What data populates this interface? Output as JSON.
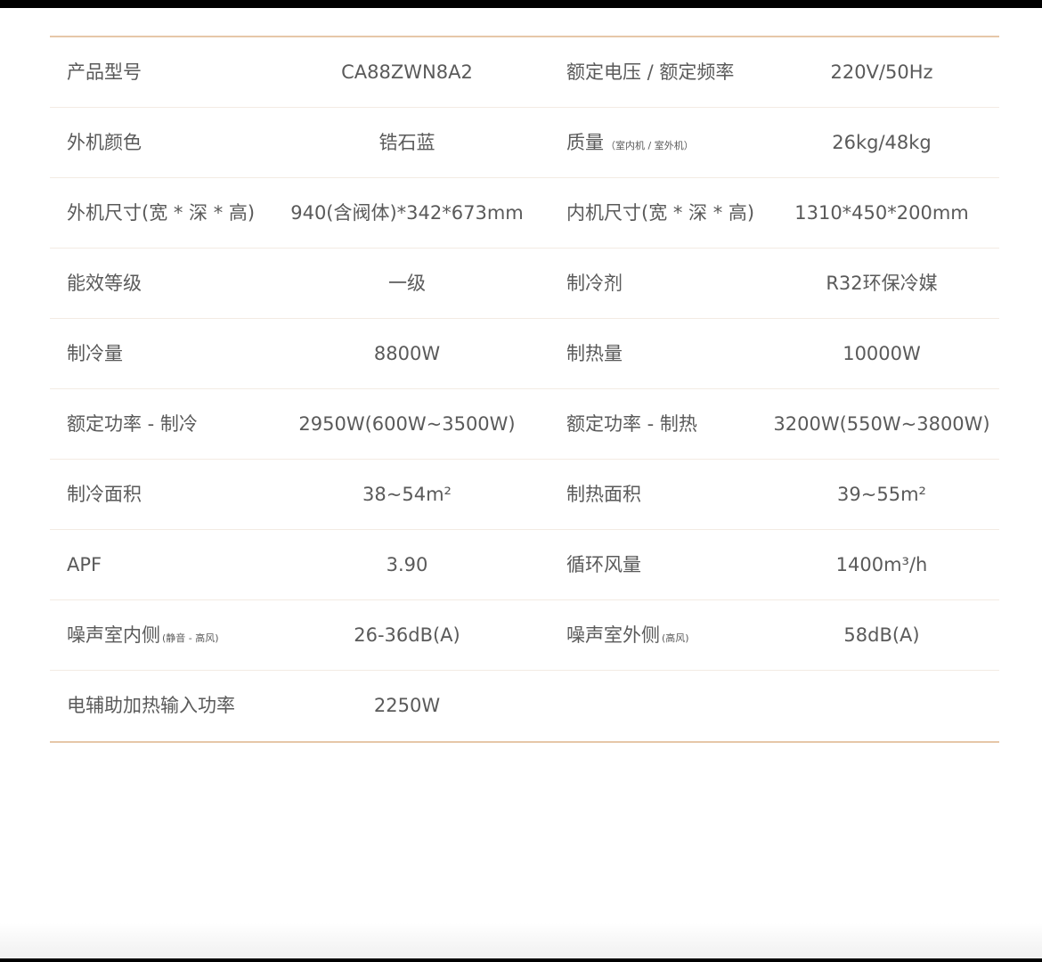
{
  "rows": [
    {
      "label1": "产品型号",
      "value1": "CA88ZWN8A2",
      "label2": "额定电压 / 额定频率",
      "value2": "220V/50Hz"
    },
    {
      "label1": "外机颜色",
      "value1": "锆石蓝",
      "label2": "质量",
      "label2_note": "（室内机 / 室外机）",
      "value2": "26kg/48kg"
    },
    {
      "label1": "外机尺寸(宽 * 深 * 高)",
      "value1": "940(含阀体)*342*673mm",
      "label2": "内机尺寸(宽 * 深 * 高)",
      "value2": "1310*450*200mm"
    },
    {
      "label1": "能效等级",
      "value1": "一级",
      "label2": "制冷剂",
      "value2": "R32环保冷媒"
    },
    {
      "label1": "制冷量",
      "value1": "8800W",
      "label2": "制热量",
      "value2": "10000W"
    },
    {
      "label1": "额定功率 - 制冷",
      "value1": "2950W(600W~3500W)",
      "label2": "额定功率 - 制热",
      "value2": "3200W(550W~3800W)"
    },
    {
      "label1": "制冷面积",
      "value1": "38~54m²",
      "label2": "制热面积",
      "value2": "39~55m²"
    },
    {
      "label1": "APF",
      "value1": "3.90",
      "label2": "循环风量",
      "value2": "1400m³/h"
    },
    {
      "label1": "噪声室内侧",
      "label1_note": "(静音 - 高风)",
      "value1": "26-36dB(A)",
      "label2": "噪声室外侧",
      "label2_note": "(高风)",
      "value2": "58dB(A)"
    },
    {
      "label1": "电辅助加热输入功率",
      "value1": "2250W",
      "label2": "",
      "value2": ""
    }
  ]
}
